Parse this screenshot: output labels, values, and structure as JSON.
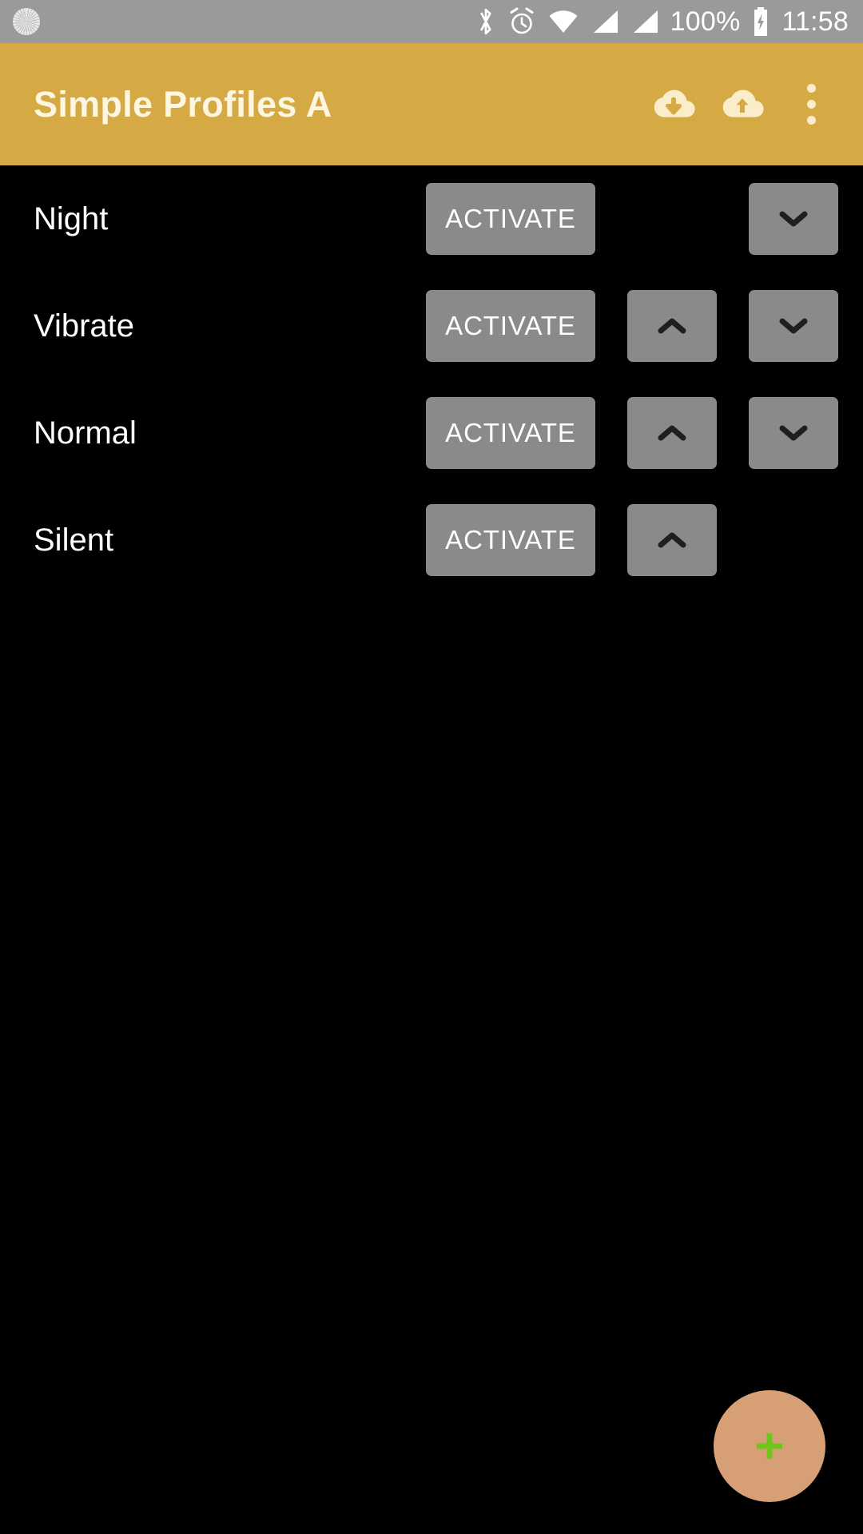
{
  "status_bar": {
    "background_color": "#9a9a9a",
    "left_icons": [
      {
        "name": "sync-spinner-icon",
        "label": "sync"
      }
    ],
    "right_icons": [
      {
        "name": "bluetooth-icon",
        "label": "bluetooth"
      },
      {
        "name": "alarm-icon",
        "label": "alarm"
      },
      {
        "name": "wifi-icon",
        "label": "wifi"
      },
      {
        "name": "signal-sim1-icon",
        "label": "cellular-signal-1"
      },
      {
        "name": "signal-sim2-icon",
        "label": "cellular-signal-2"
      }
    ],
    "battery_percent": "100%",
    "battery_icon": "battery-charging-icon",
    "clock": "11:58"
  },
  "app_bar": {
    "title": "Simple Profiles A",
    "background_color": "#d5aa44",
    "title_color": "#fdf6e0",
    "actions": [
      {
        "name": "cloud-download-icon",
        "label": "Import"
      },
      {
        "name": "cloud-upload-icon",
        "label": "Export"
      },
      {
        "name": "overflow-menu-icon",
        "label": "More options"
      }
    ]
  },
  "main": {
    "background_color": "#000000",
    "button_color": "#8a8a8a",
    "activate_label": "ACTIVATE",
    "move_up_label": "Move up",
    "move_down_label": "Move down",
    "profiles": [
      {
        "name": "Night",
        "activate": "ACTIVATE",
        "can_move_up": false,
        "can_move_down": true
      },
      {
        "name": "Vibrate",
        "activate": "ACTIVATE",
        "can_move_up": true,
        "can_move_down": true
      },
      {
        "name": "Normal",
        "activate": "ACTIVATE",
        "can_move_up": true,
        "can_move_down": true
      },
      {
        "name": "Silent",
        "activate": "ACTIVATE",
        "can_move_up": true,
        "can_move_down": false
      }
    ]
  },
  "fab": {
    "name": "add-profile-button",
    "label": "Add profile",
    "icon": "plus-icon",
    "background_color": "#d79f76",
    "icon_color": "#6ec61a"
  }
}
